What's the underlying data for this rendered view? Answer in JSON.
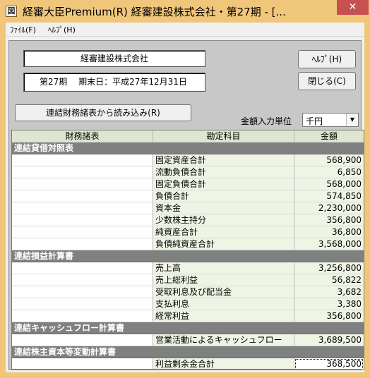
{
  "window": {
    "title": "経審大臣Premium(R)  経審建設株式会社・第27期 - [...",
    "close_glyph": "✕",
    "icon_glyph": "図"
  },
  "menu": [
    "ﾌｧｲﾙ(F)",
    "ﾍﾙﾌﾟ(H)"
  ],
  "info": {
    "company": "経審建設株式会社",
    "period": "第27期　 期末日：平成27年12月31日"
  },
  "buttons": {
    "help": "ﾍﾙﾌﾟ(H)",
    "close": "閉じる(C)",
    "import": "連結財務諸表から読み込み(R)"
  },
  "unit": {
    "label": "金額入力単位",
    "value": "千円"
  },
  "table": {
    "headers": [
      "財務諸表",
      "勘定科目",
      "金額"
    ],
    "rows": [
      {
        "type": "section",
        "statement": "連結貸借対照表",
        "account": "",
        "amount": ""
      },
      {
        "type": "data",
        "statement": "",
        "account": "固定資産合計",
        "amount": "568,900"
      },
      {
        "type": "data",
        "statement": "",
        "account": "流動負債合計",
        "amount": "6,850"
      },
      {
        "type": "data",
        "statement": "",
        "account": "固定負債合計",
        "amount": "568,000"
      },
      {
        "type": "data",
        "statement": "",
        "account": "負債合計",
        "amount": "574,850"
      },
      {
        "type": "data",
        "statement": "",
        "account": "資本金",
        "amount": "2,230,000"
      },
      {
        "type": "data",
        "statement": "",
        "account": "少数株主持分",
        "amount": "356,800"
      },
      {
        "type": "data",
        "statement": "",
        "account": "純資産合計",
        "amount": "36,800"
      },
      {
        "type": "data",
        "statement": "",
        "account": "負債純資産合計",
        "amount": "3,568,000"
      },
      {
        "type": "section",
        "statement": "連結損益計算書",
        "account": "",
        "amount": ""
      },
      {
        "type": "data",
        "statement": "",
        "account": "売上高",
        "amount": "3,256,800"
      },
      {
        "type": "data",
        "statement": "",
        "account": "売上総利益",
        "amount": "56,822"
      },
      {
        "type": "data",
        "statement": "",
        "account": "受取利息及び配当金",
        "amount": "3,682"
      },
      {
        "type": "data",
        "statement": "",
        "account": "支払利息",
        "amount": "3,380"
      },
      {
        "type": "data",
        "statement": "",
        "account": "経常利益",
        "amount": "356,800"
      },
      {
        "type": "section",
        "statement": "連結キャッシュフロー計算書",
        "account": "",
        "amount": ""
      },
      {
        "type": "data",
        "statement": "",
        "account": "営業活動によるキャッシュフロー",
        "amount": "3,689,500"
      },
      {
        "type": "section",
        "statement": "連結株主資本等変動計算書",
        "account": "",
        "amount": ""
      },
      {
        "type": "data",
        "statement": "",
        "account": "利益剰余金合計",
        "amount": "368,500",
        "selected": true
      }
    ]
  },
  "colors": {
    "titlebar": "#f0c77a",
    "close_button": "#c75050",
    "section_row": "#808080",
    "header_row": "#dfe6d0",
    "editable_cell": "#eef5e4"
  }
}
